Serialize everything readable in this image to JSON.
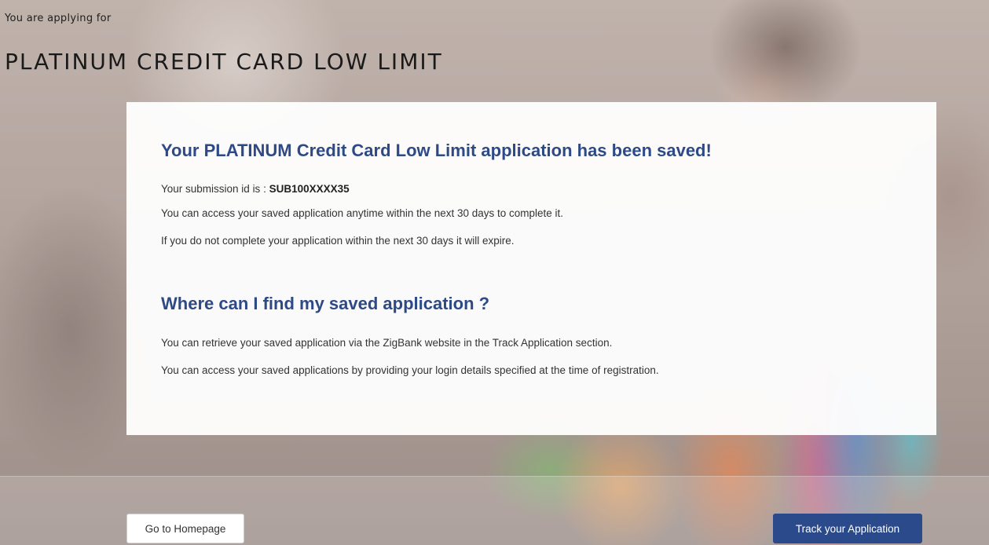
{
  "header": {
    "subtitle": "You are applying for",
    "title": "PLATINUM CREDIT CARD LOW LIMIT"
  },
  "confirmation": {
    "heading": "Your PLATINUM Credit Card Low Limit application has been saved!",
    "submission_label": "Your submission id is : ",
    "submission_id": "SUB100XXXX35",
    "access_note": "You can access your saved application anytime within the next 30 days to complete it.",
    "expiry_note": "If you do not complete your application within the next 30 days it will expire."
  },
  "help": {
    "heading": "Where can I find my saved application ?",
    "retrieve_note": "You can retrieve your saved application via the ZigBank website in the Track Application section.",
    "login_note": "You can access your saved applications by providing your login details specified at the time of registration."
  },
  "actions": {
    "home_label": "Go to Homepage",
    "track_label": "Track your Application"
  },
  "colors": {
    "heading": "#2d4a86",
    "primary_button": "#2b4a8b"
  }
}
